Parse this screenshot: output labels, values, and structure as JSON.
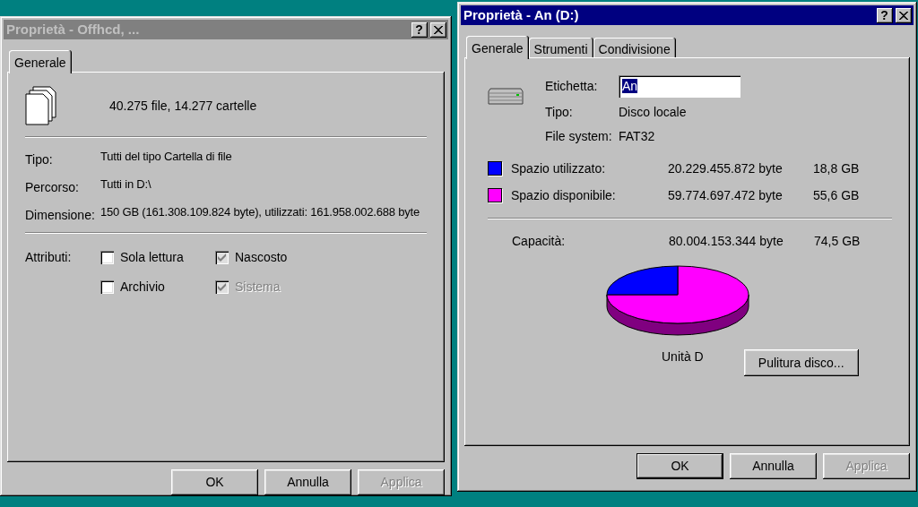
{
  "windows": [
    {
      "kind": "folder",
      "title": "Proprietà - Offhcd, ...",
      "active": false,
      "help_button": "?",
      "tabs": [
        {
          "label": "Generale",
          "selected": true
        }
      ],
      "summary": "40.275 file, 14.277 cartelle",
      "details": [
        {
          "label": "Tipo:",
          "value": "Tutti del tipo Cartella di file"
        },
        {
          "label": "Percorso:",
          "value": "Tutti in D:\\"
        },
        {
          "label": "Dimensione:",
          "value": "150 GB (161.308.109.824 byte), utilizzati: 161.958.002.688 byte"
        }
      ],
      "attributes": {
        "label": "Attributi:",
        "options": [
          {
            "label": "Sola lettura",
            "checked": false,
            "mixed": false,
            "disabled": false
          },
          {
            "label": "Nascosto",
            "checked": true,
            "mixed": true,
            "disabled": false
          },
          {
            "label": "Archivio",
            "checked": false,
            "mixed": false,
            "disabled": false
          },
          {
            "label": "Sistema",
            "checked": true,
            "mixed": true,
            "disabled": true
          }
        ]
      },
      "buttons": [
        {
          "label": "OK",
          "default": false,
          "disabled": false
        },
        {
          "label": "Annulla",
          "default": false,
          "disabled": false
        },
        {
          "label": "Applica",
          "default": false,
          "disabled": true
        }
      ]
    },
    {
      "kind": "drive",
      "title": "Proprietà - An (D:)",
      "active": true,
      "help_button": "?",
      "tabs": [
        {
          "label": "Generale",
          "selected": true
        },
        {
          "label": "Strumenti",
          "selected": false
        },
        {
          "label": "Condivisione",
          "selected": false
        }
      ],
      "label_field": {
        "label": "Etichetta:",
        "value": "An",
        "selected": true
      },
      "details": [
        {
          "label": "Tipo:",
          "value": "Disco locale"
        },
        {
          "label": "File system:",
          "value": "FAT32"
        }
      ],
      "usage": [
        {
          "label": "Spazio utilizzato:",
          "bytes": "20.229.455.872 byte",
          "size": "18,8 GB",
          "color": "#0000ff"
        },
        {
          "label": "Spazio disponibile:",
          "bytes": "59.774.697.472 byte",
          "size": "55,6 GB",
          "color": "#ff00ff"
        }
      ],
      "capacity": {
        "label": "Capacità:",
        "bytes": "80.004.153.344 byte",
        "size": "74,5 GB"
      },
      "pie": {
        "label": "Unità D"
      },
      "cleanup_button": "Pulitura disco...",
      "buttons": [
        {
          "label": "OK",
          "default": true,
          "disabled": false
        },
        {
          "label": "Annulla",
          "default": false,
          "disabled": false
        },
        {
          "label": "Applica",
          "default": false,
          "disabled": true
        }
      ]
    }
  ]
}
